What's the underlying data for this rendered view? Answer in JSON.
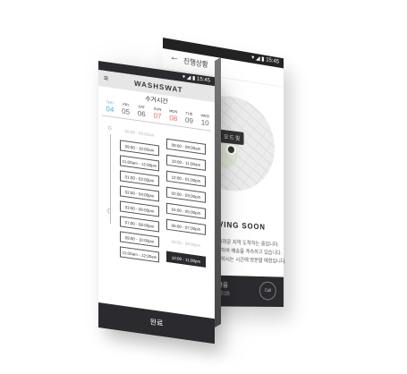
{
  "back_screen": {
    "status_time": "15:45",
    "title": "진행상황",
    "map_pin_label": "오 드 릿",
    "arriving_title": "ARRIVING SOON",
    "info_lines": [
      "현재 가장 가까운 지역 도착하는 중입니다.",
      "세탁을 접수하여 배송을 계속하고 있습니다.",
      "고객님이 원하시는 시간에 방문할 예정입니다."
    ],
    "footer_text": "오 드 로 좋음",
    "rating_text": "★★★★★ 7/25",
    "footer_button": "Call"
  },
  "front_screen": {
    "status_time": "15:45",
    "brand": "WASHSWAT",
    "subtitle": "수거시간",
    "days": [
      {
        "name": "THU",
        "date": "04",
        "state": "selected"
      },
      {
        "name": "FRI",
        "date": "05",
        "state": "normal"
      },
      {
        "name": "SAT",
        "date": "06",
        "state": "normal"
      },
      {
        "name": "SUN",
        "date": "07",
        "state": "sunday"
      },
      {
        "name": "MON",
        "date": "08",
        "state": "sunday"
      },
      {
        "name": "TUE",
        "date": "09",
        "state": "normal"
      },
      {
        "name": "WED",
        "date": "10",
        "state": "normal"
      }
    ],
    "slots_left": [
      {
        "label": "08:00 - 09:00am",
        "state": "disabled"
      },
      {
        "label": "09:00 - 10:00am",
        "state": "normal"
      },
      {
        "label": "11:00am - 12:00pm",
        "state": "normal"
      },
      {
        "label": "01:00 - 02:00pm",
        "state": "normal"
      },
      {
        "label": "02:00 - 04:00pm",
        "state": "normal"
      },
      {
        "label": "03:00 - 06:00pm",
        "state": "normal"
      },
      {
        "label": "07:00 - 08:00pm",
        "state": "normal"
      },
      {
        "label": "09:00 - 10:00pm",
        "state": "normal"
      },
      {
        "label": "11:00am - 12:00am",
        "state": "normal"
      }
    ],
    "slots_right": [
      {
        "label": "08:00 - 09:00am",
        "state": "normal"
      },
      {
        "label": "10:00 - 11:00am",
        "state": "normal"
      },
      {
        "label": "12:00 - 01:00pm",
        "state": "normal"
      },
      {
        "label": "02:00 - 03:00pm",
        "state": "normal"
      },
      {
        "label": "04:00 - 05:00pm",
        "state": "normal"
      },
      {
        "label": "06:00 - 07:00pm",
        "state": "normal"
      },
      {
        "label": "08:00 - 09:00pm",
        "state": "disabled"
      },
      {
        "label": "10:00 - 11:00pm",
        "state": "active"
      }
    ],
    "done_button": "완료"
  },
  "colors": {
    "accent": "#39b0e0",
    "sunday": "#e66666",
    "dark": "#2b2b2f"
  }
}
